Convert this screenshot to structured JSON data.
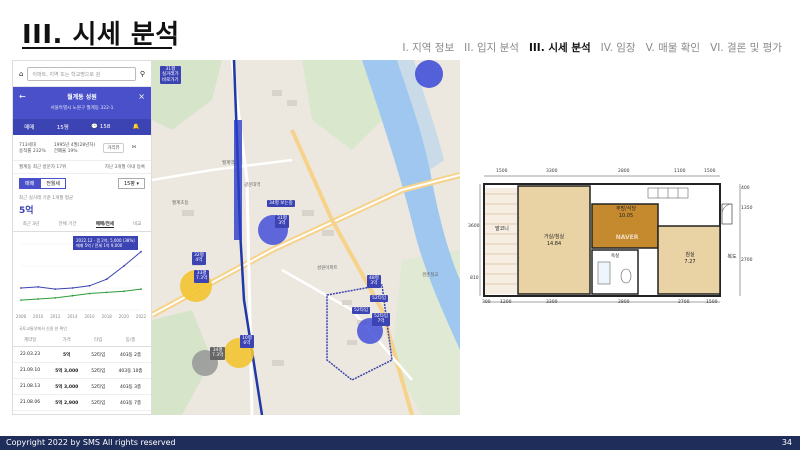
{
  "slide": {
    "title": "III. 시세 분석",
    "nav": [
      "I. 지역 정보",
      "II. 입지 분석",
      "III. 시세 분석",
      "IV. 임장",
      "V. 매물 확인",
      "VI. 결론 및 평가"
    ],
    "active_nav_index": 2,
    "footer": "Copyright 2022 by SMS  All rights reserved",
    "page_number": "34"
  },
  "phone": {
    "search_placeholder": "아파트, 지역 또는 학교명으로 검",
    "complex_name": "월계동 성원",
    "address": "서울특별시 노원구 월계동 322-1",
    "tabs": {
      "trade": "매매",
      "size": "15평",
      "comments": "158"
    },
    "info": {
      "units": "713세대",
      "built": "1995년 4월(28년차)",
      "floor_ratio": "용적률 232%",
      "coverage": "건폐율 19%",
      "btn_distance": "거리뷰"
    },
    "ranking_row": "월계동 최근 방문자 17위",
    "ranking_right": "지난 3개월 이내 등록",
    "toggle": [
      "매매",
      "전월세"
    ],
    "size_select": "15평 ▾",
    "recent_label": "최근 실거래 기준 1개월 평균",
    "recent_price": "5억",
    "chart_tabs": [
      "최근 3년",
      "전체 기간",
      "매매/전세",
      "비교"
    ],
    "chart_tip_line1": "2022.12 · 갭 2억, 5,000 (38%)",
    "chart_tip_line2": "매매 5억 / 전세 1억 9,000",
    "chart_note": "국토교통부에서 신용 한 확인",
    "table_headers": [
      "계약일",
      "가격",
      "타입",
      "동/층"
    ],
    "rows": [
      [
        "22.03.23",
        "5억",
        "52타입",
        "403동 2층"
      ],
      [
        "21.09.10",
        "5억 3,000",
        "52타입",
        "403동 10층"
      ],
      [
        "21.08.13",
        "5억 3,000",
        "52타입",
        "403동 3층"
      ],
      [
        "21.08.06",
        "5억 2,900",
        "52타입",
        "403동 7층"
      ],
      [
        "21.07.29",
        "5억 500",
        "52타입",
        "404동 6층"
      ]
    ]
  },
  "map": {
    "pins": [
      {
        "label": "31평\n3억",
        "kind": "blue"
      },
      {
        "label": "34평 보는중",
        "kind": "blue"
      },
      {
        "label": "33평\n7.3억",
        "kind": "blue"
      },
      {
        "label": "32평\n4억",
        "kind": "blue"
      },
      {
        "label": "34평\n7.3억",
        "kind": "gray"
      },
      {
        "label": "10평\n6억",
        "kind": "blue"
      },
      {
        "label": "48평\n3억",
        "kind": "blue"
      },
      {
        "label": "52타입",
        "kind": "blue"
      },
      {
        "label": "52타입",
        "kind": "blue"
      },
      {
        "label": "52타입\n7억",
        "kind": "blue"
      }
    ],
    "labels": [
      "월계역",
      "광운대역",
      "월계초등",
      "성원아파트",
      "경춘철교"
    ],
    "station_tag": "31평\n실거래가\n바로가기"
  },
  "floorplan": {
    "top_dims": [
      "1500",
      "3300",
      "2800",
      "1100",
      "1500"
    ],
    "bottom_dims": [
      "300",
      "1200",
      "3300",
      "2800",
      "2700",
      "1500"
    ],
    "left_dims": [
      "3600",
      "810"
    ],
    "right_dims": [
      "400",
      "1350",
      "2700"
    ],
    "rooms": [
      {
        "name": "발코니",
        "area": ""
      },
      {
        "name": "거실/침실",
        "area": "14.84"
      },
      {
        "name": "주방/식당",
        "area": "10.05"
      },
      {
        "name": "침실",
        "area": "7.27"
      },
      {
        "name": "욕실",
        "area": ""
      },
      {
        "name": "복도",
        "area": ""
      }
    ],
    "watermark": "NAVER"
  },
  "chart_data": {
    "type": "line",
    "title": "",
    "xlabel": "",
    "ylabel": "",
    "x": [
      "2008",
      "2010",
      "2012",
      "2014",
      "2016",
      "2018",
      "2020",
      "2022"
    ],
    "series": [
      {
        "name": "매매",
        "values": [
          2.0,
          2.1,
          1.9,
          2.0,
          2.2,
          2.8,
          4.0,
          5.3
        ]
      },
      {
        "name": "전세",
        "values": [
          0.9,
          1.0,
          1.1,
          1.3,
          1.5,
          1.6,
          1.7,
          1.9
        ]
      }
    ],
    "colors": {
      "매매": "#3c43b3",
      "전세": "#2e9c3a"
    }
  }
}
